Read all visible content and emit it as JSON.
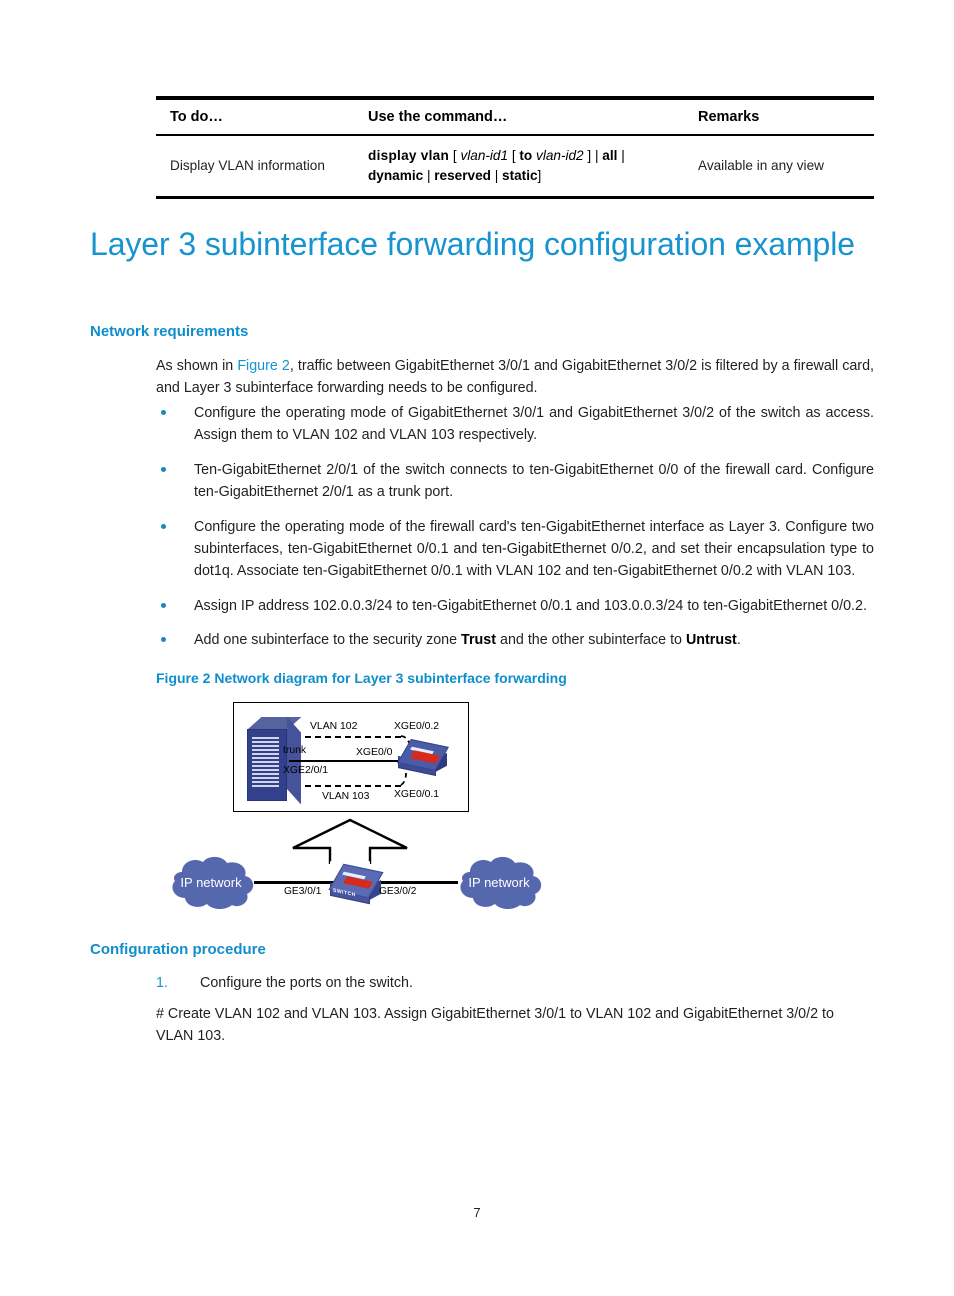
{
  "table": {
    "headers": [
      "To do…",
      "Use the command…",
      "Remarks"
    ],
    "rows": [
      {
        "todo": "Display VLAN information",
        "command_plain": "display vlan [ vlan-id1 [ to vlan-id2 ] | all | dynamic | reserved | static ]",
        "command_parts": {
          "p1": "display vlan",
          "b1": "[",
          "i1": "vlan-id1",
          "b2": "[",
          "p2": "to",
          "i2": "vlan-id2",
          "b3": "]",
          "bar1": "|",
          "p3": "all",
          "bar2": "|",
          "p4": "dynamic",
          "bar3": "|",
          "p5": "reserved",
          "bar4": "|",
          "p6": "static",
          "b4": "]"
        },
        "remarks": "Available in any view"
      }
    ]
  },
  "title": "Layer 3 subinterface forwarding configuration example",
  "sections": {
    "network_requirements": {
      "heading": "Network requirements",
      "intro_pre": "As shown in ",
      "intro_link": "Figure 2",
      "intro_post": ", traffic between GigabitEthernet 3/0/1 and GigabitEthernet 3/0/2 is filtered by a firewall card, and Layer 3 subinterface forwarding needs to be configured.",
      "bullets": [
        "Configure the operating mode of GigabitEthernet 3/0/1 and GigabitEthernet 3/0/2 of the switch as access. Assign them to VLAN 102 and VLAN 103 respectively.",
        "Ten-GigabitEthernet 2/0/1 of the switch connects to ten-GigabitEthernet 0/0 of the firewall card. Configure ten-GigabitEthernet 2/0/1 as a trunk port.",
        "Configure the operating mode of the firewall card's ten-GigabitEthernet interface as Layer 3. Configure two subinterfaces, ten-GigabitEthernet 0/0.1 and ten-GigabitEthernet 0/0.2, and set their encapsulation type to dot1q. Associate ten-GigabitEthernet 0/0.1 with VLAN 102 and ten-GigabitEthernet 0/0.2 with VLAN 103.",
        "Assign IP address 102.0.0.3/24 to ten-GigabitEthernet 0/0.1 and 103.0.0.3/24 to ten-GigabitEthernet 0/0.2."
      ],
      "bullet_last": {
        "pre": "Add one subinterface to the security zone ",
        "bold1": "Trust",
        "mid": " and the other subinterface to ",
        "bold2": "Untrust",
        "post": "."
      }
    },
    "figure": {
      "caption": "Figure 2 Network diagram for Layer 3 subinterface forwarding",
      "labels": {
        "vlan102": "VLAN 102",
        "vlan103": "VLAN 103",
        "trunk": "trunk",
        "xge201": "XGE2/0/1",
        "xge00": "XGE0/0",
        "xge0021": "XGE0/0.2",
        "xge0011": "XGE0/0.1",
        "ip_network_left": "IP network",
        "ip_network_right": "IP network",
        "ge301": "GE3/0/1",
        "ge302": "GE3/0/2",
        "switch_word": "SWITCH"
      }
    },
    "configuration_procedure": {
      "heading": "Configuration procedure",
      "step_number": "1.",
      "step_text": "Configure the ports on the switch.",
      "comment": "# Create VLAN 102 and VLAN 103. Assign GigabitEthernet 3/0/1 to VLAN 102 and GigabitEthernet 3/0/2 to VLAN 103."
    }
  },
  "page_number": "7",
  "colors": {
    "heading_blue": "#0f8ecb",
    "title_blue": "#1794d0",
    "bullet_blue": "#1b86c4",
    "cloud_blue": "#5568ae",
    "chassis_blue": "#33418c",
    "accent_red": "#d52b1e"
  }
}
